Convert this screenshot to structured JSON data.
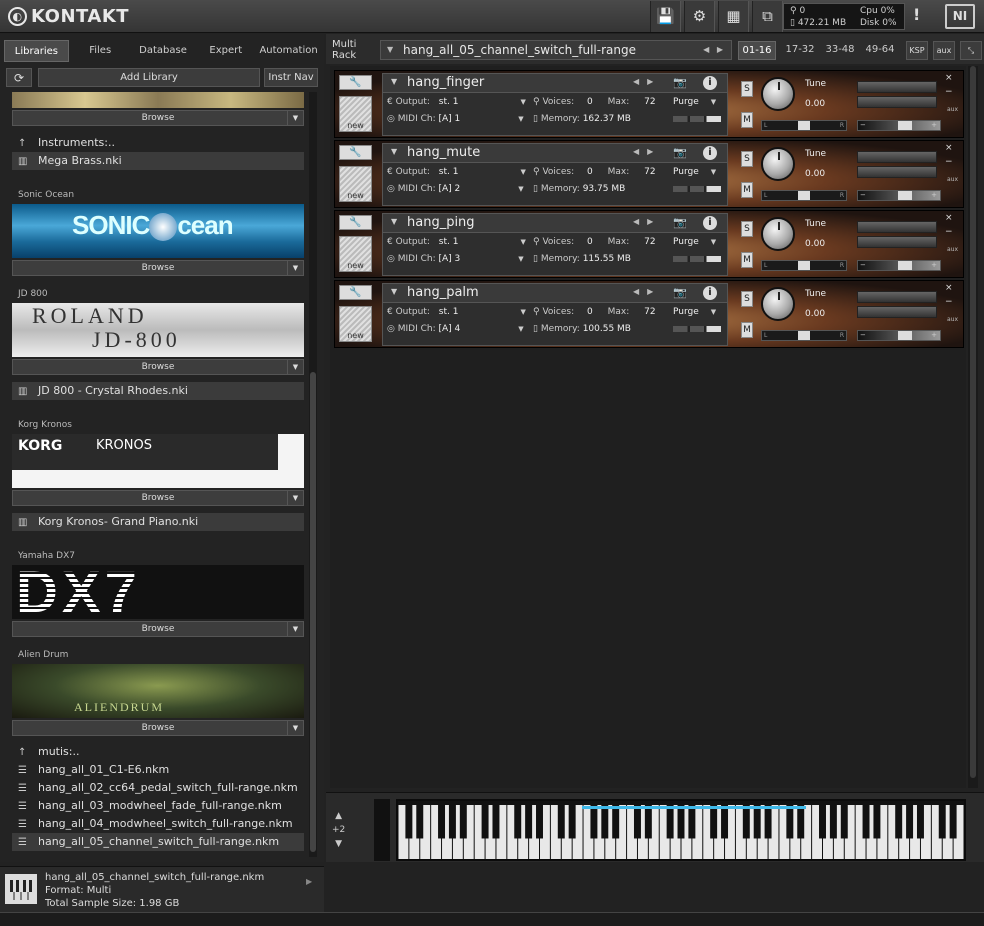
{
  "app": {
    "title": "KONTAKT"
  },
  "toolbar": {
    "save_icon": "save-icon",
    "gear_icon": "gear-icon",
    "view_icon": "view-icon",
    "minimize_icon": "minimize-icon"
  },
  "stats": {
    "voices": "0",
    "memory": "472.21 MB",
    "cpu_label": "Cpu",
    "cpu_value": "0%",
    "disk_label": "Disk",
    "disk_value": "0%"
  },
  "warning": "!",
  "ni_logo": "NI",
  "browser": {
    "tabs": [
      "Libraries",
      "Files",
      "Database",
      "Expert",
      "Automation"
    ],
    "active_tab": "Libraries",
    "add_library": "Add Library",
    "instr_nav": "Instr Nav",
    "browse_label": "Browse",
    "instruments_folder": "Instruments:..",
    "libraries": [
      {
        "name": "",
        "file": "Mega Brass.nki"
      },
      {
        "name": "Sonic Ocean",
        "file": ""
      },
      {
        "name": "JD 800",
        "file": "JD 800 - Crystal Rhodes.nki"
      },
      {
        "name": "Korg Kronos",
        "file": "Korg Kronos- Grand Piano.nki"
      },
      {
        "name": "Yamaha DX7",
        "file": ""
      },
      {
        "name": "Alien Drum",
        "file": ""
      }
    ],
    "banner_texts": {
      "sonic": "SONIC",
      "ocean": "cean",
      "roland": "ROLAND",
      "jd800": "JD-800",
      "korg": "KORG",
      "kronos": "KRONOS",
      "dx7": "DX7",
      "alien": "ALIENDRUM"
    },
    "multis_folder": "mutis:..",
    "multis": [
      "hang_all_01_C1-E6.nkm",
      "hang_all_02_cc64_pedal_switch_full-range.nkm",
      "hang_all_03_modwheel_fade_full-range.nkm",
      "hang_all_04_modwheel_switch_full-range.nkm",
      "hang_all_05_channel_switch_full-range.nkm"
    ],
    "selected_multi": "hang_all_05_channel_switch_full-range.nkm"
  },
  "info": {
    "filename": "hang_all_05_channel_switch_full-range.nkm",
    "format": "Format: Multi",
    "size": "Total Sample Size: 1.98 GB"
  },
  "rack": {
    "label": "Multi\nRack",
    "label1": "Multi",
    "label2": "Rack",
    "name": "hang_all_05_channel_switch_full-range",
    "pages": [
      "01-16",
      "17-32",
      "33-48",
      "49-64"
    ],
    "active_page": "01-16",
    "ksp": "KSP",
    "aux": "aux"
  },
  "instruments": [
    {
      "name": "hang_finger",
      "output": "st. 1",
      "voices": "0",
      "max": "72",
      "midi": "[A]  1",
      "memory": "162.37 MB",
      "tune": "0.00"
    },
    {
      "name": "hang_mute",
      "output": "st. 1",
      "voices": "0",
      "max": "72",
      "midi": "[A]  2",
      "memory": "93.75 MB",
      "tune": "0.00"
    },
    {
      "name": "hang_ping",
      "output": "st. 1",
      "voices": "0",
      "max": "72",
      "midi": "[A]  3",
      "memory": "115.55 MB",
      "tune": "0.00"
    },
    {
      "name": "hang_palm",
      "output": "st. 1",
      "voices": "0",
      "max": "72",
      "midi": "[A]  4",
      "memory": "100.55 MB",
      "tune": "0.00"
    }
  ],
  "inst_labels": {
    "output": "Output:",
    "voices": "Voices:",
    "max": "Max:",
    "midi": "MIDI Ch:",
    "memory": "Memory:",
    "purge": "Purge",
    "tune": "Tune",
    "solo": "S",
    "mute": "M",
    "new": "new",
    "aux": "aux",
    "pan_l": "L",
    "pan_r": "R",
    "vol_minus": "−",
    "vol_plus": "+",
    "close": "×",
    "minimize": "−"
  },
  "keyboard": {
    "octave": "+2"
  }
}
